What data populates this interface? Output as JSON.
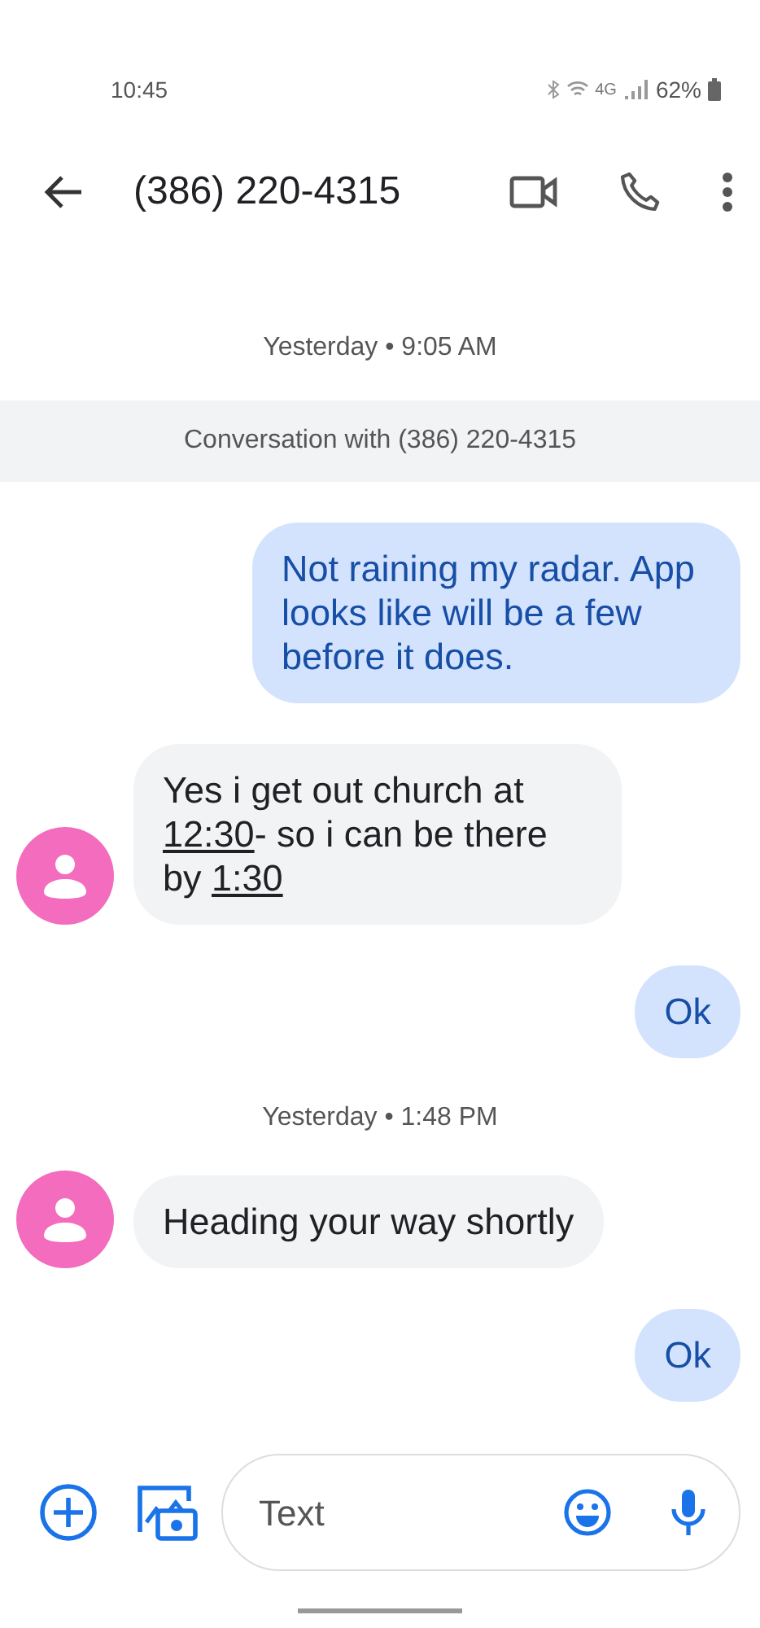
{
  "status_bar": {
    "time": "10:45",
    "network": "4G",
    "battery": "62%"
  },
  "header": {
    "title": "(386) 220-4315"
  },
  "items": [
    {
      "kind": "timestamp",
      "text": "Yesterday • 9:05 AM"
    },
    {
      "kind": "banner",
      "text": "Conversation with (386) 220-4315"
    },
    {
      "kind": "outgoing_message",
      "parts": [
        {
          "kind": "text",
          "text": "Not raining my radar. App looks like will be a few before it does."
        }
      ]
    },
    {
      "kind": "incoming_message",
      "parts": [
        {
          "kind": "text",
          "text": "Yes i get out church at "
        },
        {
          "kind": "link",
          "text": "12:30"
        },
        {
          "kind": "text",
          "text": "- so i can be there by "
        },
        {
          "kind": "link",
          "text": "1:30"
        }
      ]
    },
    {
      "kind": "outgoing_message",
      "parts": [
        {
          "kind": "text",
          "text": "Ok"
        }
      ]
    },
    {
      "kind": "timestamp",
      "text": "Yesterday • 1:48 PM"
    },
    {
      "kind": "incoming_message",
      "parts": [
        {
          "kind": "text",
          "text": "Heading your way shortly"
        }
      ]
    },
    {
      "kind": "outgoing_message",
      "parts": [
        {
          "kind": "text",
          "text": "Ok"
        }
      ]
    }
  ],
  "composer": {
    "placeholder": "Text"
  }
}
